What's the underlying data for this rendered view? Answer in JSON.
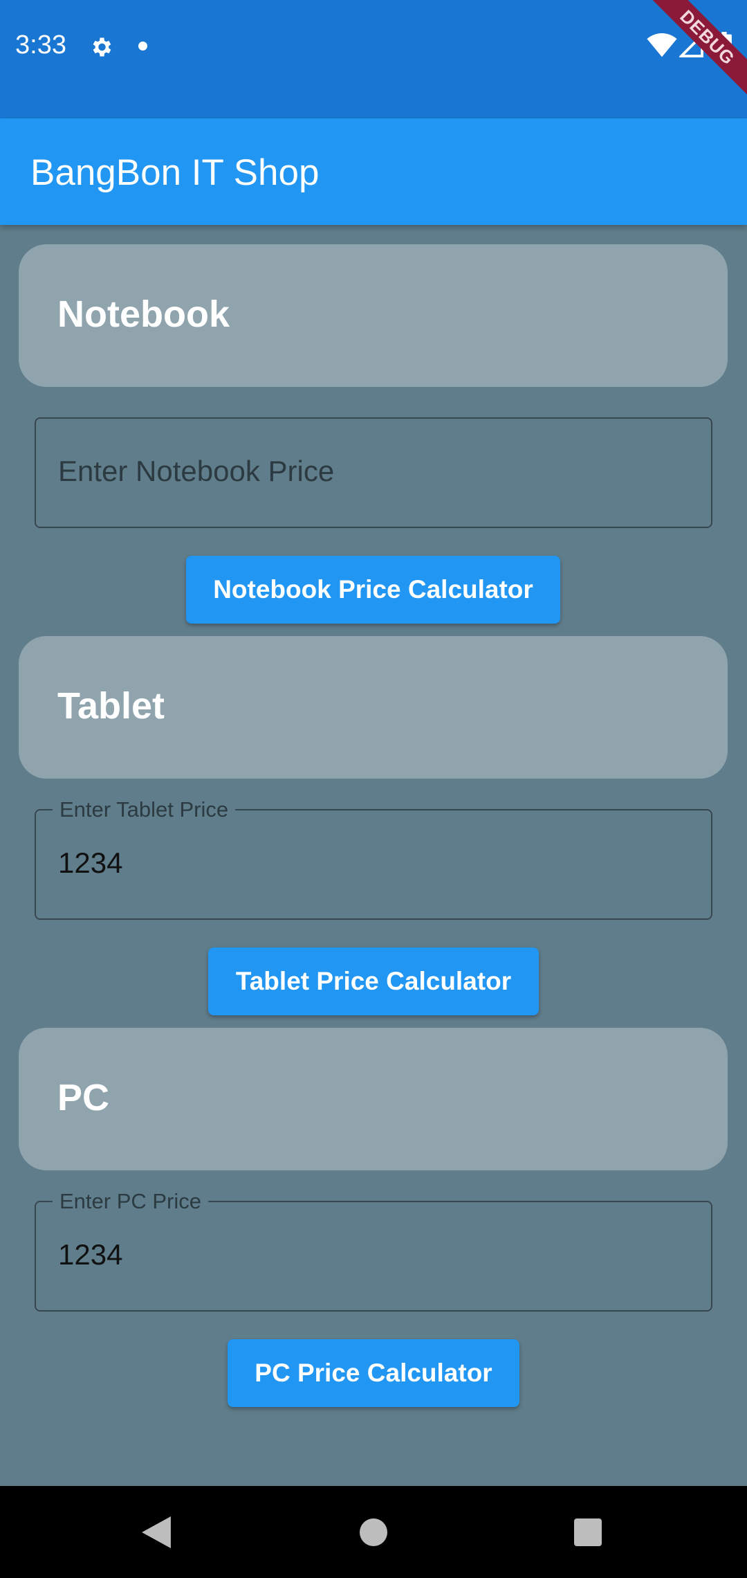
{
  "status_bar": {
    "time": "3:33",
    "debug_label": "DEBUG",
    "icons": [
      "gear-icon",
      "notification-dot-icon",
      "wifi-icon",
      "signal-icon",
      "battery-icon"
    ]
  },
  "app_bar": {
    "title": "BangBon IT Shop",
    "color": "#2196f3"
  },
  "sections": [
    {
      "title": "Notebook",
      "field": {
        "label": "",
        "placeholder": "Enter Notebook Price",
        "value": ""
      },
      "button_label": "Notebook Price Calculator"
    },
    {
      "title": "Tablet",
      "field": {
        "label": "Enter Tablet Price",
        "placeholder": "",
        "value": "1234"
      },
      "button_label": "Tablet Price Calculator"
    },
    {
      "title": "PC",
      "field": {
        "label": "Enter PC Price",
        "placeholder": "",
        "value": "1234"
      },
      "button_label": "PC Price Calculator"
    }
  ],
  "nav_bar": {
    "icons": [
      "back-icon",
      "home-icon",
      "recents-icon"
    ]
  },
  "colors": {
    "background": "#607d8b",
    "card": "#90a4ae",
    "button": "#2196f3",
    "status_bar": "#1976d2"
  }
}
